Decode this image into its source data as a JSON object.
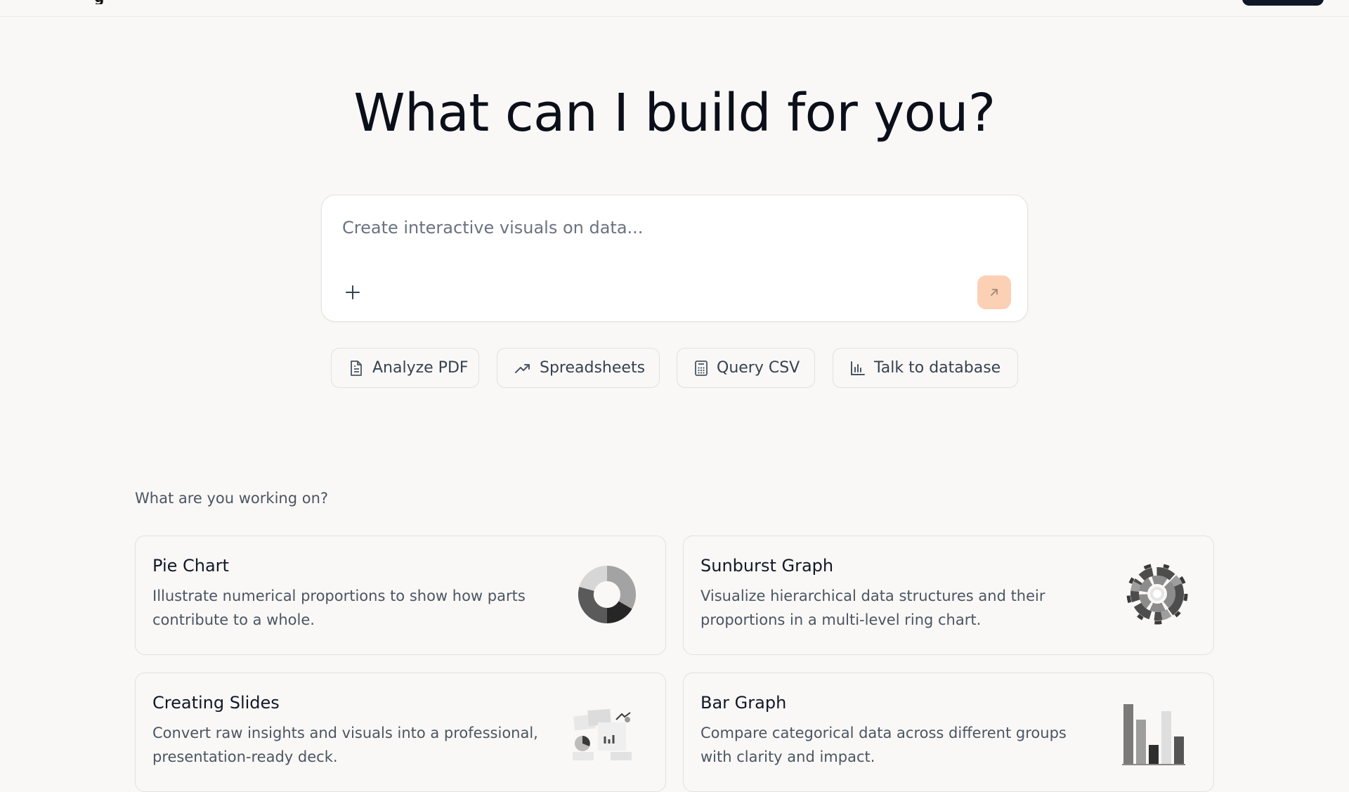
{
  "hero": {
    "title": "What can I build for you?"
  },
  "prompt": {
    "placeholder": "Create interactive visuals on data...",
    "value": ""
  },
  "chips": [
    {
      "label": "Analyze PDF",
      "icon": "document-icon"
    },
    {
      "label": "Spreadsheets",
      "icon": "trending-up-icon"
    },
    {
      "label": "Query CSV",
      "icon": "calculator-icon"
    },
    {
      "label": "Talk to database",
      "icon": "bar-chart-icon"
    }
  ],
  "section": {
    "label": "What are you working on?"
  },
  "cards": [
    {
      "title": "Pie Chart",
      "description": "Illustrate numerical proportions to show how parts contribute to a whole.",
      "icon": "donut-chart-illustration"
    },
    {
      "title": "Sunburst Graph",
      "description": "Visualize hierarchical data structures and their proportions in a multi-level ring chart.",
      "icon": "sunburst-illustration"
    },
    {
      "title": "Creating Slides",
      "description": "Convert raw insights and visuals into a professional, presentation-ready deck.",
      "icon": "slides-illustration"
    },
    {
      "title": "Bar Graph",
      "description": "Compare categorical data across different groups with clarity and impact.",
      "icon": "bar-graph-illustration"
    }
  ],
  "colors": {
    "background": "#f9f8f6",
    "send_button": "#fbd0b4",
    "top_button": "#0f1729"
  }
}
